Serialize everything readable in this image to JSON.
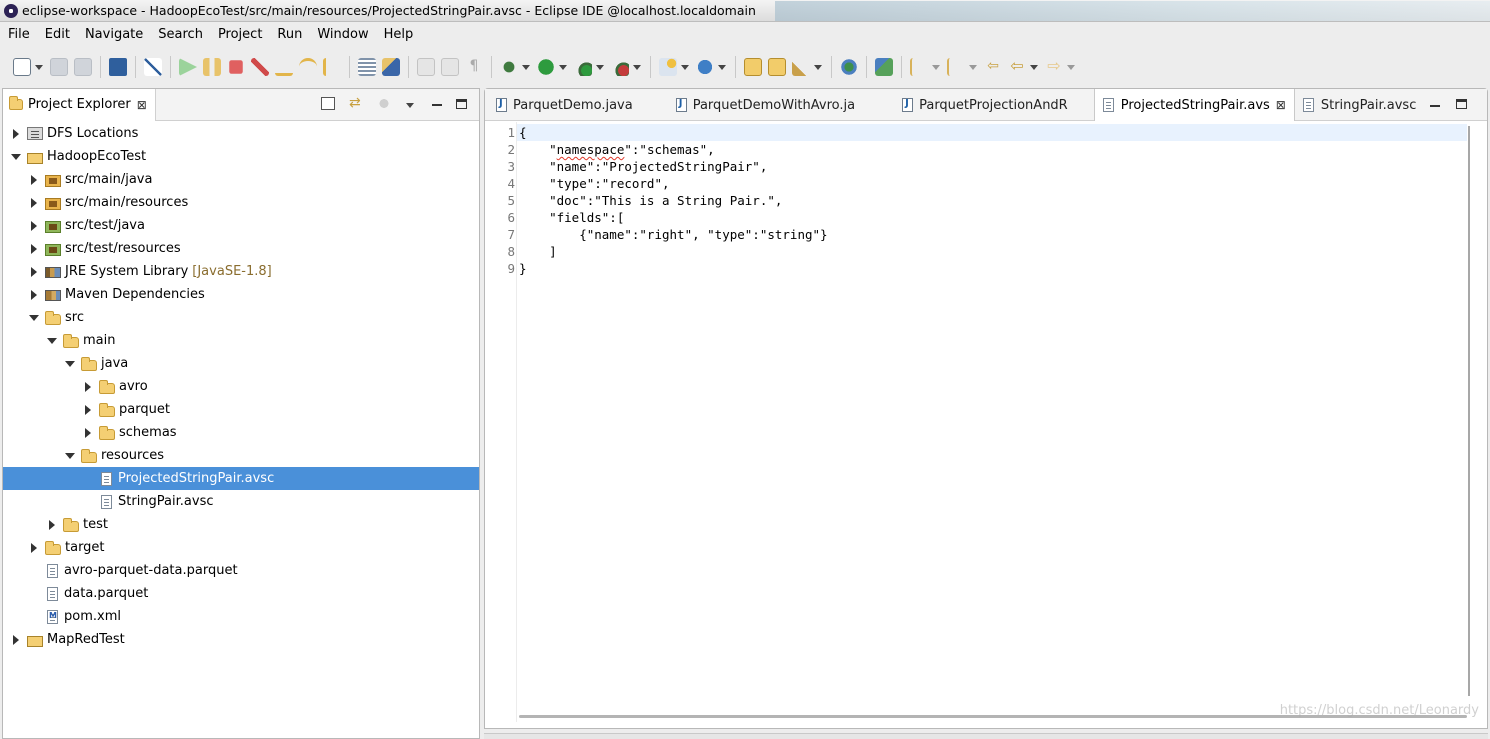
{
  "window": {
    "title": "eclipse-workspace - HadoopEcoTest/src/main/resources/ProjectedStringPair.avsc - Eclipse IDE @localhost.localdomain"
  },
  "menu": [
    "File",
    "Edit",
    "Navigate",
    "Search",
    "Project",
    "Run",
    "Window",
    "Help"
  ],
  "explorer": {
    "title": "Project Explorer",
    "tree": [
      {
        "label": "DFS Locations",
        "depth": 0,
        "toggle": "closed",
        "icon": "dfs"
      },
      {
        "label": "HadoopEcoTest",
        "depth": 0,
        "toggle": "open",
        "icon": "project"
      },
      {
        "label": "src/main/java",
        "depth": 1,
        "toggle": "closed",
        "icon": "pkgfolder"
      },
      {
        "label": "src/main/resources",
        "depth": 1,
        "toggle": "closed",
        "icon": "pkgfolder"
      },
      {
        "label": "src/test/java",
        "depth": 1,
        "toggle": "closed",
        "icon": "testfolder"
      },
      {
        "label": "src/test/resources",
        "depth": 1,
        "toggle": "closed",
        "icon": "testfolder"
      },
      {
        "label": "JRE System Library",
        "decor": "[JavaSE-1.8]",
        "depth": 1,
        "toggle": "closed",
        "icon": "jre"
      },
      {
        "label": "Maven Dependencies",
        "depth": 1,
        "toggle": "closed",
        "icon": "maven"
      },
      {
        "label": "src",
        "depth": 1,
        "toggle": "open",
        "icon": "folder"
      },
      {
        "label": "main",
        "depth": 2,
        "toggle": "open",
        "icon": "folder"
      },
      {
        "label": "java",
        "depth": 3,
        "toggle": "open",
        "icon": "folder"
      },
      {
        "label": "avro",
        "depth": 4,
        "toggle": "closed",
        "icon": "folder"
      },
      {
        "label": "parquet",
        "depth": 4,
        "toggle": "closed",
        "icon": "folder"
      },
      {
        "label": "schemas",
        "depth": 4,
        "toggle": "closed",
        "icon": "folder"
      },
      {
        "label": "resources",
        "depth": 3,
        "toggle": "open",
        "icon": "folder"
      },
      {
        "label": "ProjectedStringPair.avsc",
        "depth": 4,
        "toggle": "none",
        "icon": "file",
        "selected": true
      },
      {
        "label": "StringPair.avsc",
        "depth": 4,
        "toggle": "none",
        "icon": "file"
      },
      {
        "label": "test",
        "depth": 2,
        "toggle": "closed",
        "icon": "folder"
      },
      {
        "label": "target",
        "depth": 1,
        "toggle": "closed",
        "icon": "folder"
      },
      {
        "label": "avro-parquet-data.parquet",
        "depth": 1,
        "toggle": "none",
        "icon": "file"
      },
      {
        "label": "data.parquet",
        "depth": 1,
        "toggle": "none",
        "icon": "file"
      },
      {
        "label": "pom.xml",
        "depth": 1,
        "toggle": "none",
        "icon": "mfile"
      },
      {
        "label": "MapRedTest",
        "depth": 0,
        "toggle": "closed",
        "icon": "project"
      }
    ]
  },
  "editor": {
    "tabs": [
      {
        "label": "ParquetDemo.java",
        "icon": "java"
      },
      {
        "label": "ParquetDemoWithAvro.ja",
        "icon": "java"
      },
      {
        "label": "ParquetProjectionAndR",
        "icon": "java"
      },
      {
        "label": "ProjectedStringPair.avs",
        "icon": "text",
        "active": true
      },
      {
        "label": "StringPair.avsc",
        "icon": "text"
      }
    ],
    "lines": [
      "{",
      "    \"namespace\":\"schemas\",",
      "    \"name\":\"ProjectedStringPair\",",
      "    \"type\":\"record\",",
      "    \"doc\":\"This is a String Pair.\",",
      "    \"fields\":[",
      "        {\"name\":\"right\", \"type\":\"string\"}",
      "    ]",
      "}"
    ]
  },
  "watermark": "https://blog.csdn.net/Leonardy"
}
